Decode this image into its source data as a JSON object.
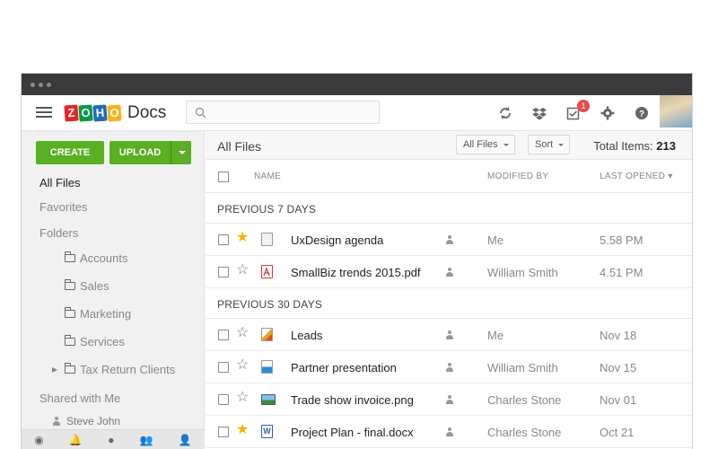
{
  "app": {
    "name": "Docs",
    "logo_letters": [
      "Z",
      "O",
      "H",
      "O"
    ],
    "logo_colors": [
      "#e42527",
      "#089949",
      "#226db4",
      "#f9b21d"
    ],
    "accent": "#5aaf23"
  },
  "topbar": {
    "search_placeholder": "",
    "icons": [
      "sync-icon",
      "dropbox-icon",
      "tasks-icon",
      "settings-icon",
      "help-icon"
    ],
    "tasks_badge": "1"
  },
  "sidebar": {
    "create_label": "CREATE",
    "upload_label": "UPLOAD",
    "all_files": "All Files",
    "favorites": "Favorites",
    "folders": "Folders",
    "folder_items": [
      "Accounts",
      "Sales",
      "Marketing",
      "Services",
      "Tax Return Clients"
    ],
    "shared_with_me": "Shared with Me",
    "shared_user": "Steve John"
  },
  "main": {
    "title": "All Files",
    "filter_label": "All Files",
    "sort_label": "Sort",
    "total_label": "Total Items:",
    "total_value": "213",
    "columns": {
      "name": "NAME",
      "modified_by": "MODIFIED BY",
      "last_opened": "LAST OPENED"
    },
    "groups": [
      {
        "label": "PREVIOUS 7 DAYS",
        "rows": [
          {
            "name": "UxDesign agenda",
            "type": "doc",
            "starred": true,
            "modified_by": "Me",
            "opened": "5.58 PM"
          },
          {
            "name": "SmallBiz trends 2015.pdf",
            "type": "pdf",
            "starred": false,
            "modified_by": "William Smith",
            "opened": "4.51 PM"
          }
        ]
      },
      {
        "label": "PREVIOUS 30 DAYS",
        "rows": [
          {
            "name": "Leads",
            "type": "sheet",
            "starred": false,
            "modified_by": "Me",
            "opened": "Nov 18"
          },
          {
            "name": "Partner presentation",
            "type": "show",
            "starred": false,
            "modified_by": "William Smith",
            "opened": "Nov 15"
          },
          {
            "name": "Trade show invoice.png",
            "type": "image",
            "starred": false,
            "modified_by": "Charles Stone",
            "opened": "Nov 01"
          },
          {
            "name": "Project Plan - final.docx",
            "type": "word",
            "starred": true,
            "modified_by": "Charles Stone",
            "opened": "Oct 21"
          }
        ]
      }
    ]
  }
}
